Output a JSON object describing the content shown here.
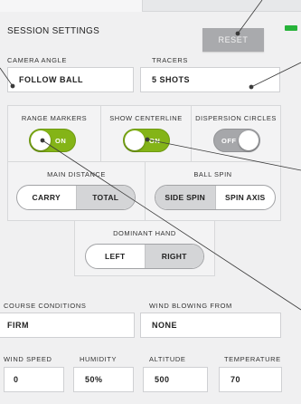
{
  "header": {
    "title": "SESSION SETTINGS",
    "reset_label": "RESET"
  },
  "camera_angle": {
    "label": "CAMERA ANGLE",
    "value": "FOLLOW BALL"
  },
  "tracers": {
    "label": "TRACERS",
    "value": "5 SHOTS"
  },
  "toggles": [
    {
      "label": "RANGE MARKERS",
      "state": "ON"
    },
    {
      "label": "SHOW CENTERLINE",
      "state": "ON"
    },
    {
      "label": "DISPERSION CIRCLES",
      "state": "OFF"
    }
  ],
  "main_distance": {
    "label": "MAIN DISTANCE",
    "options": [
      "CARRY",
      "TOTAL"
    ],
    "selected": "TOTAL"
  },
  "ball_spin": {
    "label": "BALL SPIN",
    "options": [
      "SIDE SPIN",
      "SPIN AXIS"
    ],
    "selected": "SIDE SPIN"
  },
  "dominant_hand": {
    "label": "DOMINANT HAND",
    "options": [
      "LEFT",
      "RIGHT"
    ],
    "selected": "RIGHT"
  },
  "course_conditions": {
    "label": "COURSE CONDITIONS",
    "value": "FIRM"
  },
  "wind_blowing_from": {
    "label": "WIND BLOWING FROM",
    "value": "NONE"
  },
  "wind_speed": {
    "label": "WIND SPEED",
    "value": "0"
  },
  "humidity": {
    "label": "HUMIDITY",
    "value": "50%"
  },
  "altitude": {
    "label": "ALTITUDE",
    "value": "500"
  },
  "temperature": {
    "label": "TEMPERATURE",
    "value": "70"
  },
  "colors": {
    "toggle_on": "#84b417",
    "toggle_off": "#a6a7aa",
    "reset_button": "#a9aaad",
    "battery": "#27b33a"
  }
}
